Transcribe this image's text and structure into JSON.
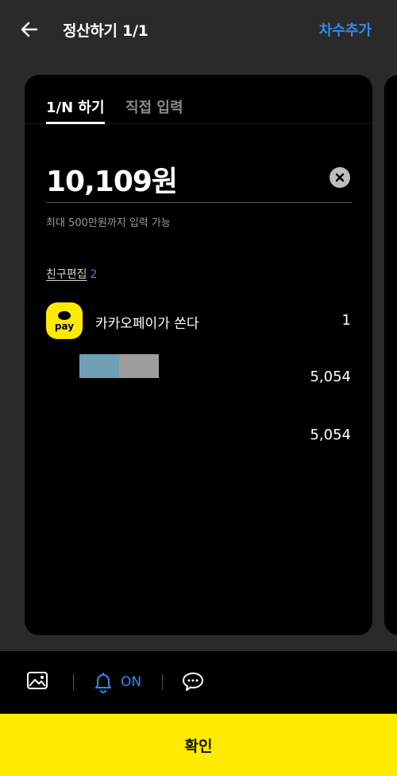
{
  "header": {
    "title": "정산하기 1/1",
    "add_round_label": "차수추가"
  },
  "tabs": [
    {
      "label": "1/N 하기",
      "active": true
    },
    {
      "label": "직접 입력",
      "active": false
    }
  ],
  "amount": {
    "value": "10,109원",
    "hint": "최대 500만원까지 입력 가능"
  },
  "friends": {
    "edit_label": "친구편집",
    "count": "2"
  },
  "rows": [
    {
      "logo_text": "pay",
      "name": "카카오페이가 쏜다",
      "value": "1"
    },
    {
      "value": "5,054"
    },
    {
      "value": "5,054"
    }
  ],
  "bottom_bar": {
    "notify_state": "ON"
  },
  "confirm_label": "확인",
  "colors": {
    "accent_blue": "#2d8cf0",
    "kakao_yellow": "#ffeb00",
    "background": "#2a2a2a",
    "card": "#000000"
  },
  "icons": [
    "back-arrow-icon",
    "clear-icon",
    "image-icon",
    "bell-icon",
    "chat-icon"
  ]
}
